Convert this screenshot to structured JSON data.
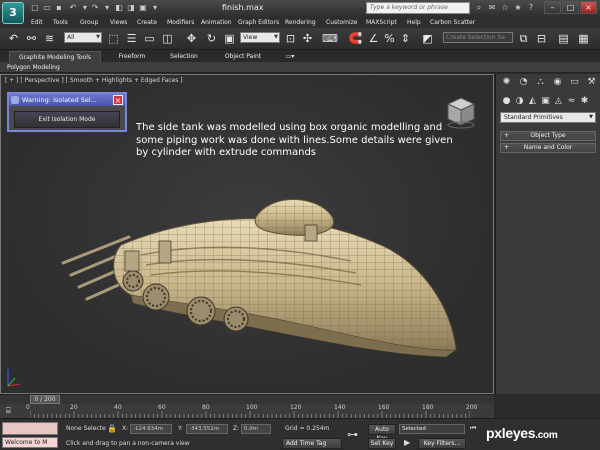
{
  "app": {
    "title": "finish.max",
    "logo_letter": "3",
    "search_placeholder": "Type a keyword or phrase"
  },
  "menu": [
    "Edit",
    "Tools",
    "Group",
    "Views",
    "Create",
    "Modifiers",
    "Animation",
    "Graph Editors",
    "Rendering",
    "Customize",
    "MAXScript",
    "Help",
    "Carbon Scatter"
  ],
  "toolbar": {
    "filter_value": "All",
    "refcoord_value": "View",
    "selection_set_placeholder": "Create Selection Se"
  },
  "ribbon": {
    "tabs": [
      "Graphite Modeling Tools",
      "Freeform",
      "Selection",
      "Object Paint"
    ],
    "subtab": "Polygon Modeling"
  },
  "viewport": {
    "label": "[ + ] [ Perspective ] [ Smooth + Highlights + Edged Faces ]",
    "dialog_title": "Warning: Isolated Sel...",
    "dialog_button": "Exit Isolation Mode",
    "annotation": "The side tank was modelled using box organic modelling and some piping work was done with lines.Some details were given by cylinder with extrude commands"
  },
  "command_panel": {
    "dropdown_value": "Standard Primitives",
    "rollouts": [
      "Object Type",
      "Name and Color"
    ]
  },
  "timeline": {
    "frame_display": "0 / 200",
    "ticks": [
      "0",
      "20",
      "40",
      "60",
      "80",
      "100",
      "120",
      "140",
      "160",
      "180",
      "200"
    ]
  },
  "status": {
    "maxscript_text": "Welcome to M",
    "selection": "None Selecte",
    "x_label": "X:",
    "x_value": "-124.634m",
    "y_label": "Y:",
    "y_value": "-343.551m",
    "z_label": "Z:",
    "z_value": "0.0m",
    "grid": "Grid = 0.254m",
    "prompt": "Click and drag to pan a non-camera view",
    "add_time_tag": "Add Time Tag",
    "auto_key": "Auto Key",
    "auto_key_value": "Selected",
    "set_key": "Set Key",
    "key_filters": "Key Filters..."
  },
  "watermark": {
    "name": "pxleyes",
    "domain": ".com"
  }
}
